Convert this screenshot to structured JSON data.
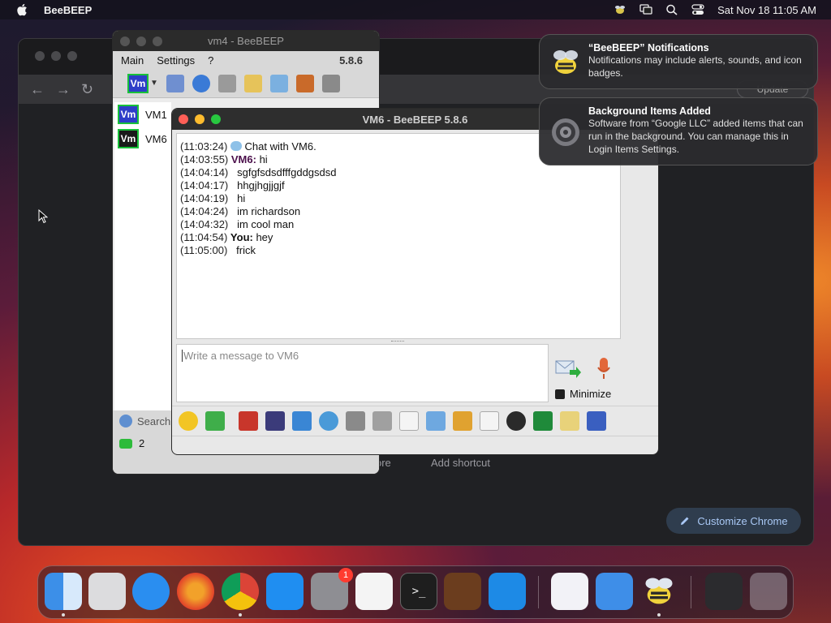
{
  "menubar": {
    "app_name": "BeeBEEP",
    "datetime": "Sat Nov 18  11:05 AM",
    "icons": [
      "apple-icon",
      "beebeep-tray-icon",
      "screen-mirroring-icon",
      "spotlight-icon",
      "control-center-icon"
    ]
  },
  "chrome": {
    "update_label": "Update",
    "more_label": "ore",
    "add_shortcut": "Add shortcut",
    "customize_label": "Customize Chrome"
  },
  "vm4_window": {
    "title": "vm4 - BeeBEEP",
    "menu": [
      "Main",
      "Settings",
      "?"
    ],
    "version": "5.8.6",
    "users": [
      {
        "badge": "Vm",
        "name": "VM1",
        "style": "blue"
      },
      {
        "badge": "Vm",
        "name": "VM6",
        "style": "dark"
      }
    ],
    "search_placeholder": "Search",
    "online_count": "2"
  },
  "vm6_window": {
    "title": "VM6 - BeeBEEP 5.8.6",
    "messages": [
      {
        "time": "(11:03:24)",
        "sender": "",
        "text": " Chat with VM6.",
        "icon": "chat-bubble-icon"
      },
      {
        "time": "(14:03:55)",
        "sender": "VM6:",
        "text": " hi",
        "icon": ""
      },
      {
        "time": "(14:04:14)",
        "sender": "",
        "text": "   sgfgfsdsdfffgddgsdsd",
        "icon": ""
      },
      {
        "time": "(14:04:17)",
        "sender": "",
        "text": "   hhgjhgjjgjf",
        "icon": ""
      },
      {
        "time": "(14:04:19)",
        "sender": "",
        "text": "   hi",
        "icon": ""
      },
      {
        "time": "(14:04:24)",
        "sender": "",
        "text": "   im richardson",
        "icon": ""
      },
      {
        "time": "(14:04:32)",
        "sender": "",
        "text": "   im cool man",
        "icon": ""
      },
      {
        "time": "(11:04:54)",
        "sender": "You:",
        "text": " hey",
        "icon": ""
      },
      {
        "time": "(11:05:00)",
        "sender": "",
        "text": "   frick",
        "icon": ""
      }
    ],
    "input_placeholder": "Write a message to VM6",
    "minimize_label": "Minimize"
  },
  "notifications": [
    {
      "title": "“BeeBEEP” Notifications",
      "body": "Notifications may include alerts, sounds, and icon badges."
    },
    {
      "title": "Background Items Added",
      "body": "Software from “Google LLC” added items that can run in the background. You can manage this in Login Items Settings."
    }
  ],
  "dock": {
    "apps": [
      "Finder",
      "Launchpad",
      "Safari",
      "Firefox",
      "Chrome",
      "App Store",
      "System Settings",
      "TextEdit",
      "Terminal",
      "GarageBand",
      "Visual Studio Code",
      "Visual Studio",
      "Weather",
      "BeeBEEP",
      "Screenshot",
      "Trash"
    ],
    "settings_badge": "1"
  }
}
